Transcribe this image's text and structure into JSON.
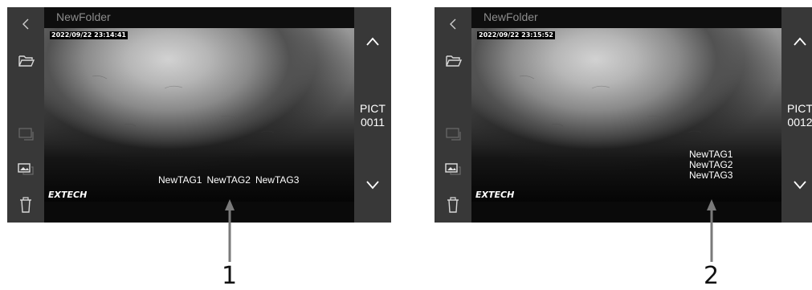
{
  "screens": [
    {
      "folder_name": "NewFolder",
      "timestamp": "2022/09/22 23:14:41",
      "brand": "EXTECH",
      "picture_label": [
        "PICT",
        "0011"
      ],
      "tags": [
        "NewTAG1",
        "NewTAG2",
        "NewTAG3"
      ],
      "tag_layout": "horizontal"
    },
    {
      "folder_name": "NewFolder",
      "timestamp": "2022/09/22 23:15:52",
      "brand": "EXTECH",
      "picture_label": [
        "PICT",
        "0012"
      ],
      "tags": [
        "NewTAG1",
        "NewTAG2",
        "NewTAG3"
      ],
      "tag_layout": "vertical"
    }
  ],
  "callouts": [
    "1",
    "2"
  ],
  "icons": {
    "back": "chevron-left-icon",
    "folder": "folder-open-icon",
    "image_view": "image-frame-icon",
    "gallery": "gallery-icon",
    "delete": "trash-icon",
    "up": "chevron-up-icon",
    "down": "chevron-down-icon"
  },
  "colors": {
    "side_bar": "#383838",
    "top_bar": "#0e0e0e",
    "folder_text": "#8c8c8c",
    "icon_dim": "#6a6a6a",
    "icon_bright": "#d8d8d8",
    "callout_arrow": "#7a7a7a"
  }
}
